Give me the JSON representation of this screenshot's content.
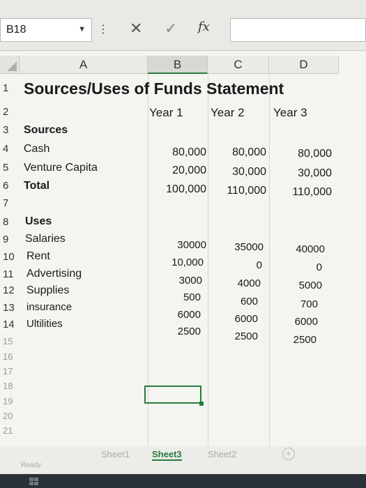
{
  "formula_bar": {
    "name_box": "B18",
    "cancel_icon": "✕",
    "enter_icon": "✓",
    "fx_label": "fx"
  },
  "columns": [
    "A",
    "B",
    "C",
    "D"
  ],
  "rows": [
    "1",
    "2",
    "3",
    "4",
    "5",
    "6",
    "7",
    "8",
    "9",
    "10",
    "11",
    "12",
    "13",
    "14",
    "15",
    "16",
    "17",
    "18",
    "19",
    "20",
    "21"
  ],
  "sheet": {
    "title": "Sources/Uses of Funds Statement",
    "year_headers": [
      "Year 1",
      "Year 2",
      "Year 3"
    ],
    "sources_label": "Sources",
    "sources": [
      {
        "label": "Cash",
        "values": [
          "80,000",
          "80,000",
          "80,000"
        ]
      },
      {
        "label": "Venture Capita",
        "values": [
          "20,000",
          "30,000",
          "30,000"
        ]
      },
      {
        "label": "Total",
        "values": [
          "100,000",
          "110,000",
          "110,000"
        ]
      }
    ],
    "uses_label": "Uses",
    "uses": [
      {
        "label": "Salaries",
        "values": [
          "30000",
          "35000",
          "40000"
        ]
      },
      {
        "label": "Rent",
        "values": [
          "10,000",
          "0",
          "0"
        ]
      },
      {
        "label": "Advertising",
        "values": [
          "3000",
          "4000",
          "5000"
        ]
      },
      {
        "label": "Supplies",
        "values": [
          "500",
          "600",
          "700"
        ]
      },
      {
        "label": "insurance",
        "values": [
          "6000",
          "6000",
          "6000"
        ]
      },
      {
        "label": "Ultilities",
        "values": [
          "2500",
          "2500",
          "2500"
        ]
      }
    ]
  },
  "tabs": [
    "Sheet1",
    "Sheet3",
    "Sheet2"
  ],
  "active_tab": "Sheet3",
  "status": "Ready",
  "colors": {
    "accent": "#2a7a3c"
  }
}
